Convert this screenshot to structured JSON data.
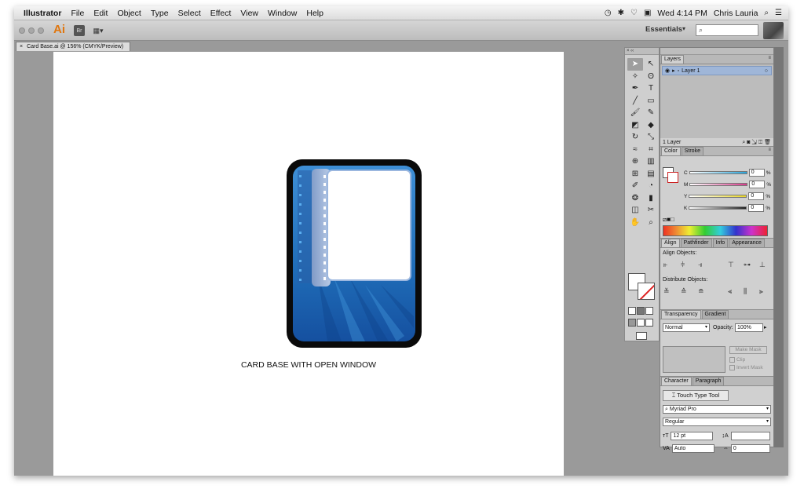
{
  "menubar": {
    "app": "Illustrator",
    "items": [
      "File",
      "Edit",
      "Object",
      "Type",
      "Select",
      "Effect",
      "View",
      "Window",
      "Help"
    ],
    "clock": "Wed 4:14 PM",
    "user": "Chris Lauria"
  },
  "appbar": {
    "logo": "Ai",
    "bridge": "Br",
    "workspace": "Essentials",
    "search_placeholder": ""
  },
  "document": {
    "tab_title": "Card Base.ai @ 156% (CMYK/Preview)",
    "caption": "CARD BASE WITH OPEN WINDOW"
  },
  "layers": {
    "tab": "Layers",
    "layer_name": "Layer 1",
    "count_label": "1 Layer"
  },
  "color": {
    "tabs": [
      "Color",
      "Stroke"
    ],
    "channels": [
      {
        "name": "C",
        "value": "0",
        "color": "#2aa3d8"
      },
      {
        "name": "M",
        "value": "0",
        "color": "#d63a8a"
      },
      {
        "name": "Y",
        "value": "0",
        "color": "#e8d62a"
      },
      {
        "name": "K",
        "value": "0",
        "color": "#222222"
      }
    ],
    "unit": "%"
  },
  "align": {
    "tabs": [
      "Align",
      "Pathfinder",
      "Info",
      "Appearance"
    ],
    "align_objects": "Align Objects:",
    "distribute_objects": "Distribute Objects:"
  },
  "transparency": {
    "tabs": [
      "Transparency",
      "Gradient"
    ],
    "blend_mode": "Normal",
    "opacity_label": "Opacity:",
    "opacity": "100%",
    "make_mask": "Make Mask",
    "clip": "Clip",
    "invert_mask": "Invert Mask"
  },
  "character": {
    "tabs": [
      "Character",
      "Paragraph"
    ],
    "touch_type": "Touch Type Tool",
    "font_family": "Myriad Pro",
    "font_style": "Regular",
    "size": "12 pt",
    "leading": "Auto",
    "tracking": "0"
  },
  "colors": {
    "card_border": "#0a0a0a",
    "card_blue": "#1e6fb8",
    "accent": "#e0760e"
  }
}
